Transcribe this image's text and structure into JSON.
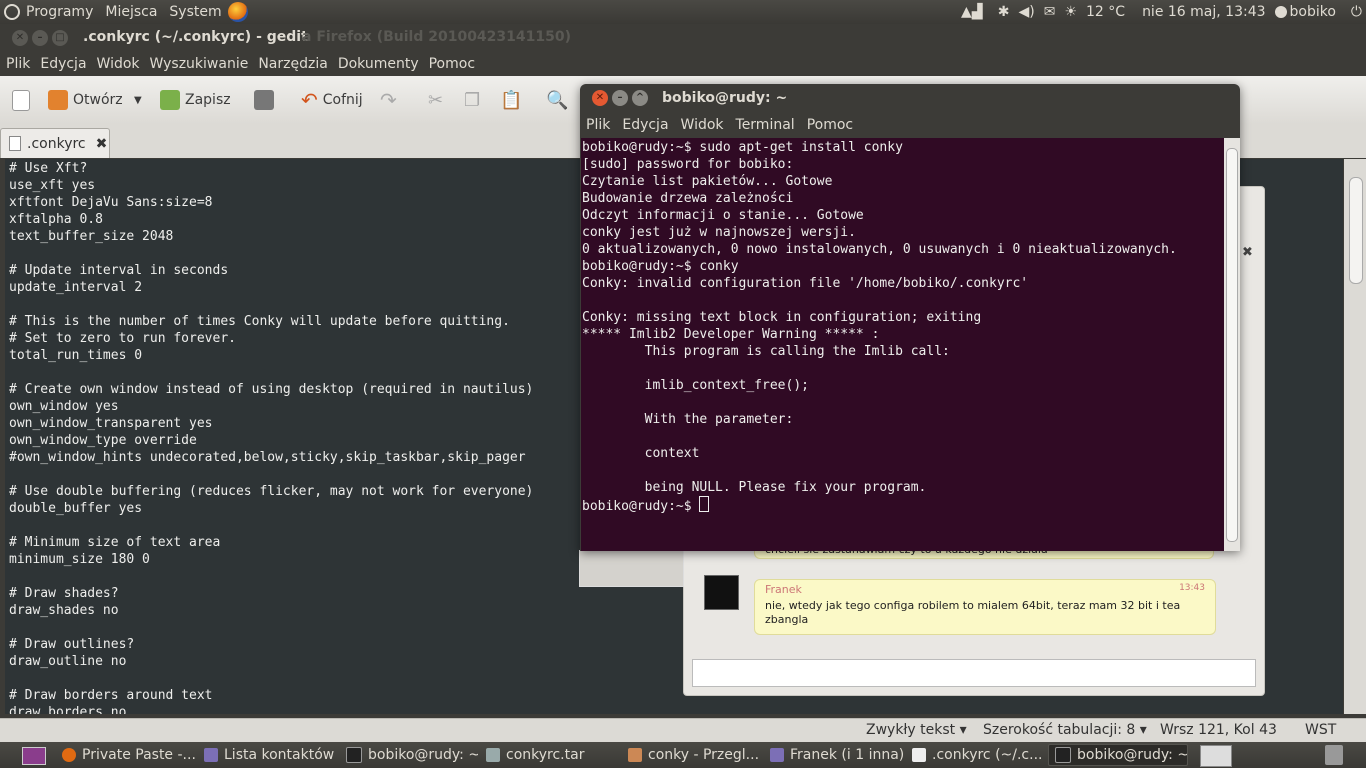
{
  "top_panel": {
    "menus": [
      "Programy",
      "Miejsca",
      "System"
    ],
    "temperature": "12 °C",
    "datetime": "nie 16 maj, 13:43",
    "user": "bobiko"
  },
  "gedit": {
    "window_title": ".conkyrc (~/.conkyrc) - gedit",
    "ghost_title": "a Firefox (Build 20100423141150)",
    "menu": [
      "Plik",
      "Edycja",
      "Widok",
      "Wyszukiwanie",
      "Narzędzia",
      "Dokumenty",
      "Pomoc"
    ],
    "toolbar": {
      "open": "Otwórz",
      "save": "Zapisz",
      "undo": "Cofnij"
    },
    "tab": ".conkyrc",
    "content": "# Use Xft?\nuse_xft yes\nxftfont DejaVu Sans:size=8\nxftalpha 0.8\ntext_buffer_size 2048\n\n# Update interval in seconds\nupdate_interval 2\n\n# This is the number of times Conky will update before quitting.\n# Set to zero to run forever.\ntotal_run_times 0\n\n# Create own window instead of using desktop (required in nautilus)\nown_window yes\nown_window_transparent yes\nown_window_type override\n#own_window_hints undecorated,below,sticky,skip_taskbar,skip_pager\n\n# Use double buffering (reduces flicker, may not work for everyone)\ndouble_buffer yes\n\n# Minimum size of text area\nminimum_size 180 0\n\n# Draw shades?\ndraw_shades no\n\n# Draw outlines?\ndraw_outline no\n\n# Draw borders around text\ndraw_borders no",
    "status": {
      "syntax": "Zwykły tekst",
      "tab_width": "Szerokość tabulacji:  8",
      "position": "Wrsz 121, Kol 43",
      "mode": "WST"
    }
  },
  "terminal": {
    "title": "bobiko@rudy: ~",
    "menu": [
      "Plik",
      "Edycja",
      "Widok",
      "Terminal",
      "Pomoc"
    ],
    "content": "bobiko@rudy:~$ sudo apt-get install conky\n[sudo] password for bobiko:\nCzytanie list pakietów... Gotowe\nBudowanie drzewa zależności\nOdczyt informacji o stanie... Gotowe\nconky jest już w najnowszej wersji.\n0 aktualizowanych, 0 nowo instalowanych, 0 usuwanych i 0 nieaktualizowanych.\nbobiko@rudy:~$ conky\nConky: invalid configuration file '/home/bobiko/.conkyrc'\n\nConky: missing text block in configuration; exiting\n***** Imlib2 Developer Warning ***** :\n        This program is calling the Imlib call:\n\n        imlib_context_free();\n\n        With the parameter:\n\n        context\n\n        being NULL. Please fix your program.",
    "prompt": "bobiko@rudy:~$ "
  },
  "chat": {
    "sender": "Franek",
    "time": "13:43",
    "message": "nie, wtedy jak tego configa robilem to mialem 64bit, teraz mam 32 bit i tea zbangla",
    "partial_line": "chcieli sie zastanawiam czy to u kazdego nie dziala"
  },
  "taskbar": [
    "Private Paste -...",
    "Lista kontaktów",
    "bobiko@rudy: ~",
    "conkyrc.tar",
    "conky - Przegl...",
    "Franek (i 1 inna)",
    ".conkyrc (~/.c...",
    "bobiko@rudy: ~"
  ],
  "colors": {
    "terminal_bg": "#300a24",
    "editor_bg": "#2e3436",
    "panel_bg": "#3c3b37",
    "close_button": "#e45932"
  }
}
